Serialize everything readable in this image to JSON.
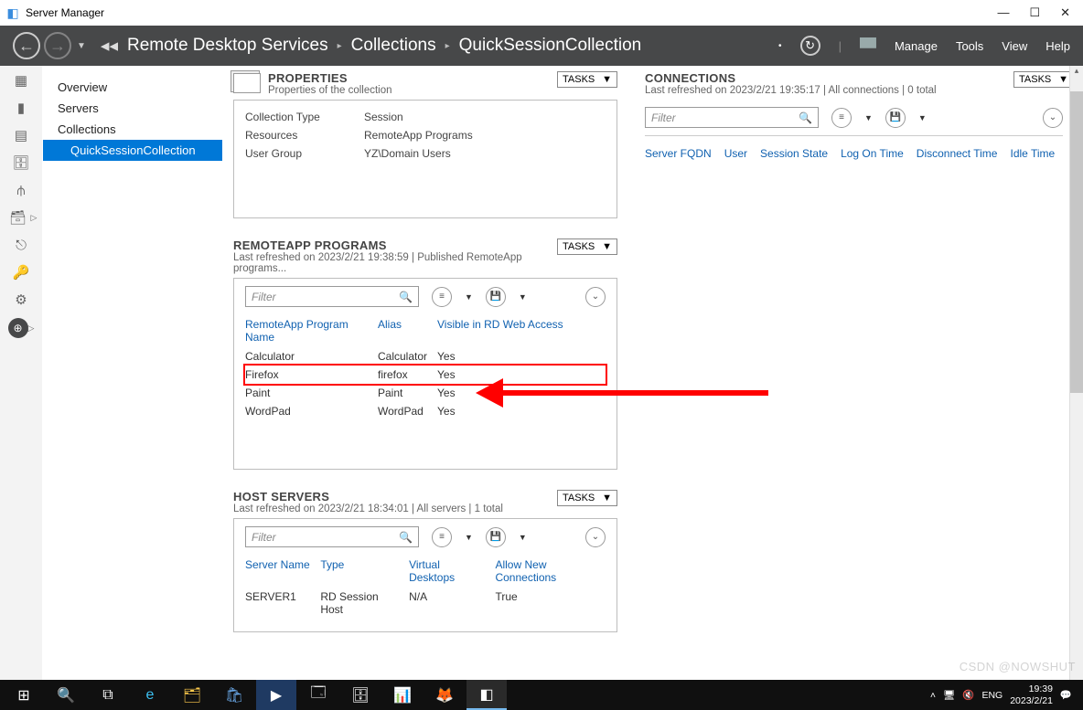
{
  "window": {
    "title": "Server Manager"
  },
  "breadcrumb": {
    "a": "Remote Desktop Services",
    "b": "Collections",
    "c": "QuickSessionCollection"
  },
  "menu": {
    "manage": "Manage",
    "tools": "Tools",
    "view": "View",
    "help": "Help",
    "tasks": "TASKS"
  },
  "sidebar": {
    "overview": "Overview",
    "servers": "Servers",
    "collections": "Collections",
    "quick": "QuickSessionCollection"
  },
  "properties": {
    "title": "PROPERTIES",
    "subtitle": "Properties of the collection",
    "rows": [
      {
        "k": "Collection Type",
        "v": "Session"
      },
      {
        "k": "Resources",
        "v": "RemoteApp Programs"
      },
      {
        "k": "User Group",
        "v": "YZ\\Domain Users"
      }
    ]
  },
  "remoteapp": {
    "title": "REMOTEAPP PROGRAMS",
    "subtitle": "Last refreshed on 2023/2/21 19:38:59 | Published RemoteApp programs...",
    "filter_placeholder": "Filter",
    "headers": {
      "name": "RemoteApp Program Name",
      "alias": "Alias",
      "vis": "Visible in RD Web Access"
    },
    "rows": [
      {
        "name": "Calculator",
        "alias": "Calculator",
        "vis": "Yes"
      },
      {
        "name": "Firefox",
        "alias": "firefox",
        "vis": "Yes"
      },
      {
        "name": "Paint",
        "alias": "Paint",
        "vis": "Yes"
      },
      {
        "name": "WordPad",
        "alias": "WordPad",
        "vis": "Yes"
      }
    ]
  },
  "hostservers": {
    "title": "HOST SERVERS",
    "subtitle": "Last refreshed on 2023/2/21 18:34:01 | All servers  | 1 total",
    "filter_placeholder": "Filter",
    "headers": {
      "name": "Server Name",
      "type": "Type",
      "vd": "Virtual Desktops",
      "allow": "Allow New Connections"
    },
    "rows": [
      {
        "name": "SERVER1",
        "type": "RD Session Host",
        "vd": "N/A",
        "allow": "True"
      }
    ]
  },
  "connections": {
    "title": "CONNECTIONS",
    "subtitle": "Last refreshed on 2023/2/21 19:35:17 | All connections  | 0 total",
    "filter_placeholder": "Filter",
    "headers": {
      "fqdn": "Server FQDN",
      "user": "User",
      "state": "Session State",
      "logon": "Log On Time",
      "disc": "Disconnect Time",
      "idle": "Idle Time"
    }
  },
  "tray": {
    "lang": "ENG",
    "time": "19:39",
    "date": "2023/2/21"
  },
  "watermark": "CSDN @NOWSHUT"
}
